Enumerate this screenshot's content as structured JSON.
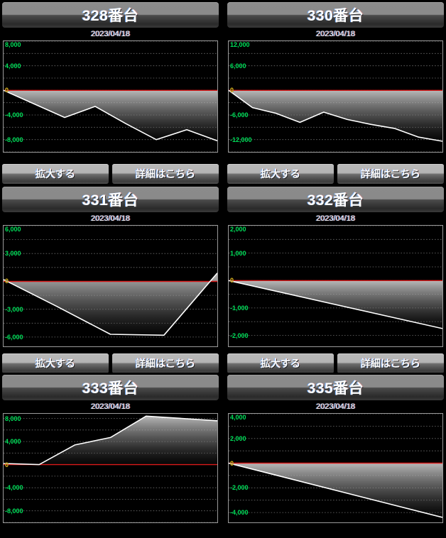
{
  "buttons": {
    "zoom_label": "拡大する",
    "detail_label": "詳細はこちら"
  },
  "colors": {
    "zero_line": "#d91a1a",
    "series_line": "#ffffff",
    "axis_label": "#00e05a",
    "zero_label": "#e8c020",
    "background": "#000000"
  },
  "panels": [
    {
      "title": "328番台",
      "date": "2023/04/18",
      "chart_data": {
        "type": "line",
        "title": "328番台",
        "xlabel": "",
        "ylabel": "",
        "ylim": [
          -10000,
          8000
        ],
        "yticks": [
          8000,
          4000,
          0,
          -4000,
          -8000
        ],
        "ytick_labels": [
          "8,000",
          "4,000",
          "0",
          "-4,000",
          "-8,000"
        ],
        "grid": true,
        "legend": "none",
        "x": [
          0,
          1,
          2,
          3,
          4,
          5,
          6,
          7
        ],
        "values": [
          0,
          -2200,
          -4400,
          -2600,
          -5400,
          -8000,
          -6400,
          -8200
        ]
      }
    },
    {
      "title": "330番台",
      "date": "2023/04/18",
      "chart_data": {
        "type": "line",
        "title": "330番台",
        "xlabel": "",
        "ylabel": "",
        "ylim": [
          -15000,
          12000
        ],
        "yticks": [
          12000,
          6000,
          0,
          -6000,
          -12000
        ],
        "ytick_labels": [
          "12,000",
          "6,000",
          "0",
          "-6,000",
          "-12,000"
        ],
        "grid": true,
        "legend": "none",
        "x": [
          0,
          1,
          2,
          3,
          4,
          5,
          6,
          7,
          8,
          9
        ],
        "values": [
          0,
          -4200,
          -5600,
          -7800,
          -5300,
          -7100,
          -8300,
          -9300,
          -11400,
          -12400
        ]
      }
    },
    {
      "title": "331番台",
      "date": "2023/04/18",
      "chart_data": {
        "type": "line",
        "title": "331番台",
        "xlabel": "",
        "ylabel": "",
        "ylim": [
          -7000,
          6000
        ],
        "yticks": [
          6000,
          3000,
          0,
          -3000,
          -6000
        ],
        "ytick_labels": [
          "6,000",
          "3,000",
          "0",
          "-3,000",
          "-6,000"
        ],
        "grid": true,
        "legend": "none",
        "x": [
          0,
          1,
          2,
          3,
          4
        ],
        "values": [
          200,
          -2700,
          -5700,
          -5800,
          900
        ]
      }
    },
    {
      "title": "332番台",
      "date": "2023/04/18",
      "chart_data": {
        "type": "line",
        "title": "332番台",
        "xlabel": "",
        "ylabel": "",
        "ylim": [
          -2400,
          2000
        ],
        "yticks": [
          2000,
          1000,
          0,
          -1000,
          -2000
        ],
        "ytick_labels": [
          "2,000",
          "1,000",
          "0",
          "-1,000",
          "-2,000"
        ],
        "grid": true,
        "legend": "none",
        "x": [
          0,
          1
        ],
        "values": [
          0,
          -1750
        ]
      }
    },
    {
      "title": "333番台",
      "date": "2023/04/18",
      "chart_data": {
        "type": "line",
        "title": "333番台",
        "xlabel": "",
        "ylabel": "",
        "ylim": [
          -10000,
          8800
        ],
        "yticks": [
          8000,
          4000,
          0,
          -4000,
          -8000
        ],
        "ytick_labels": [
          "8,000",
          "4,000",
          "0",
          "-4,000",
          "-8,000"
        ],
        "grid": true,
        "legend": "none",
        "x": [
          0,
          1,
          2,
          3,
          4,
          5,
          6
        ],
        "values": [
          200,
          0,
          3400,
          4700,
          8400,
          8000,
          7600
        ]
      }
    },
    {
      "title": "335番台",
      "date": "2023/04/18",
      "chart_data": {
        "type": "line",
        "title": "335番台",
        "xlabel": "",
        "ylabel": "",
        "ylim": [
          -4800,
          4000
        ],
        "yticks": [
          4000,
          2000,
          0,
          -2000,
          -4000
        ],
        "ytick_labels": [
          "4,000",
          "2,000",
          "0",
          "-2,000",
          "-4,000"
        ],
        "grid": true,
        "legend": "none",
        "x": [
          0,
          1
        ],
        "values": [
          0,
          -4400
        ]
      }
    }
  ]
}
